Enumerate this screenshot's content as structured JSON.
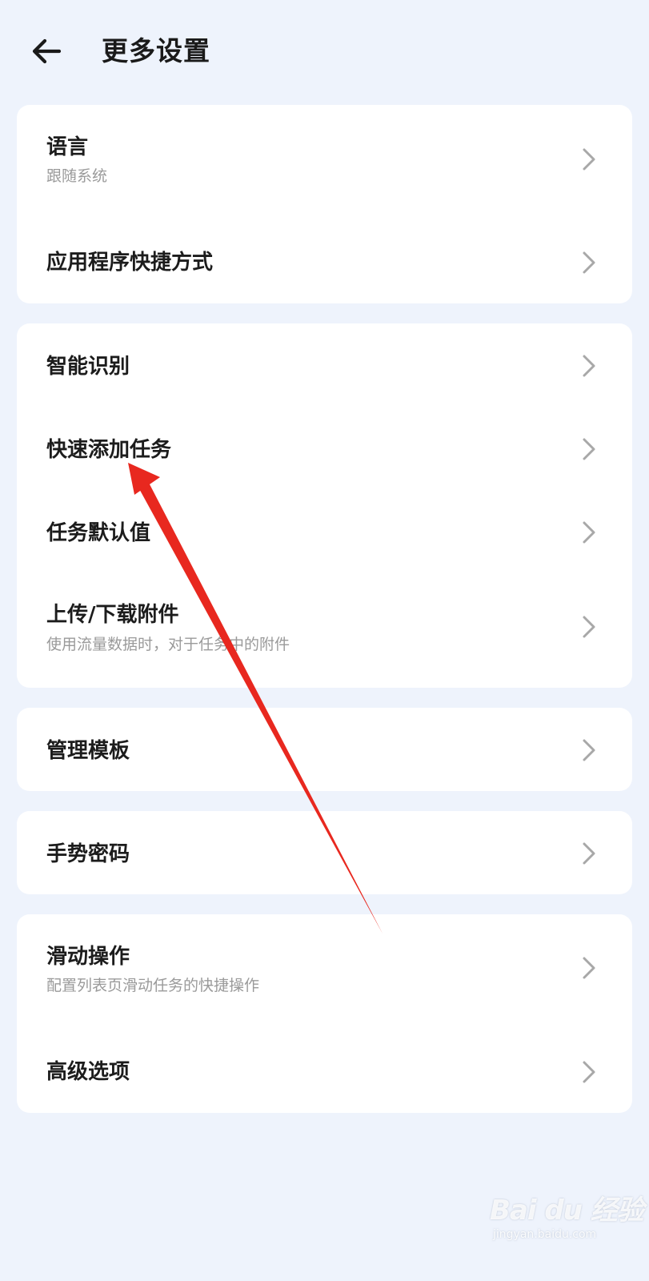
{
  "header": {
    "title": "更多设置",
    "back_icon": "arrow-left-icon"
  },
  "sections": [
    {
      "items": [
        {
          "label": "语言",
          "subtitle": "跟随系统"
        },
        {
          "label": "应用程序快捷方式"
        }
      ]
    },
    {
      "items": [
        {
          "label": "智能识别"
        },
        {
          "label": "快速添加任务"
        },
        {
          "label": "任务默认值"
        },
        {
          "label": "上传/下载附件",
          "subtitle": "使用流量数据时，对于任务中的附件"
        }
      ]
    },
    {
      "items": [
        {
          "label": "管理模板"
        }
      ]
    },
    {
      "items": [
        {
          "label": "手势密码"
        }
      ]
    },
    {
      "items": [
        {
          "label": "滑动操作",
          "subtitle": "配置列表页滑动任务的快捷操作"
        },
        {
          "label": "高级选项"
        }
      ]
    }
  ],
  "chevron_icon": "chevron-right-icon",
  "colors": {
    "background": "#eef3fc",
    "card": "#ffffff",
    "title_text": "#1c1c1c",
    "subtitle_text": "#9a9a9a",
    "chevron": "#a8a8a8",
    "annotation_arrow": "#e8281f"
  },
  "watermark": {
    "logo": "Bai du 经验",
    "url": "jingyan.baidu.com"
  }
}
